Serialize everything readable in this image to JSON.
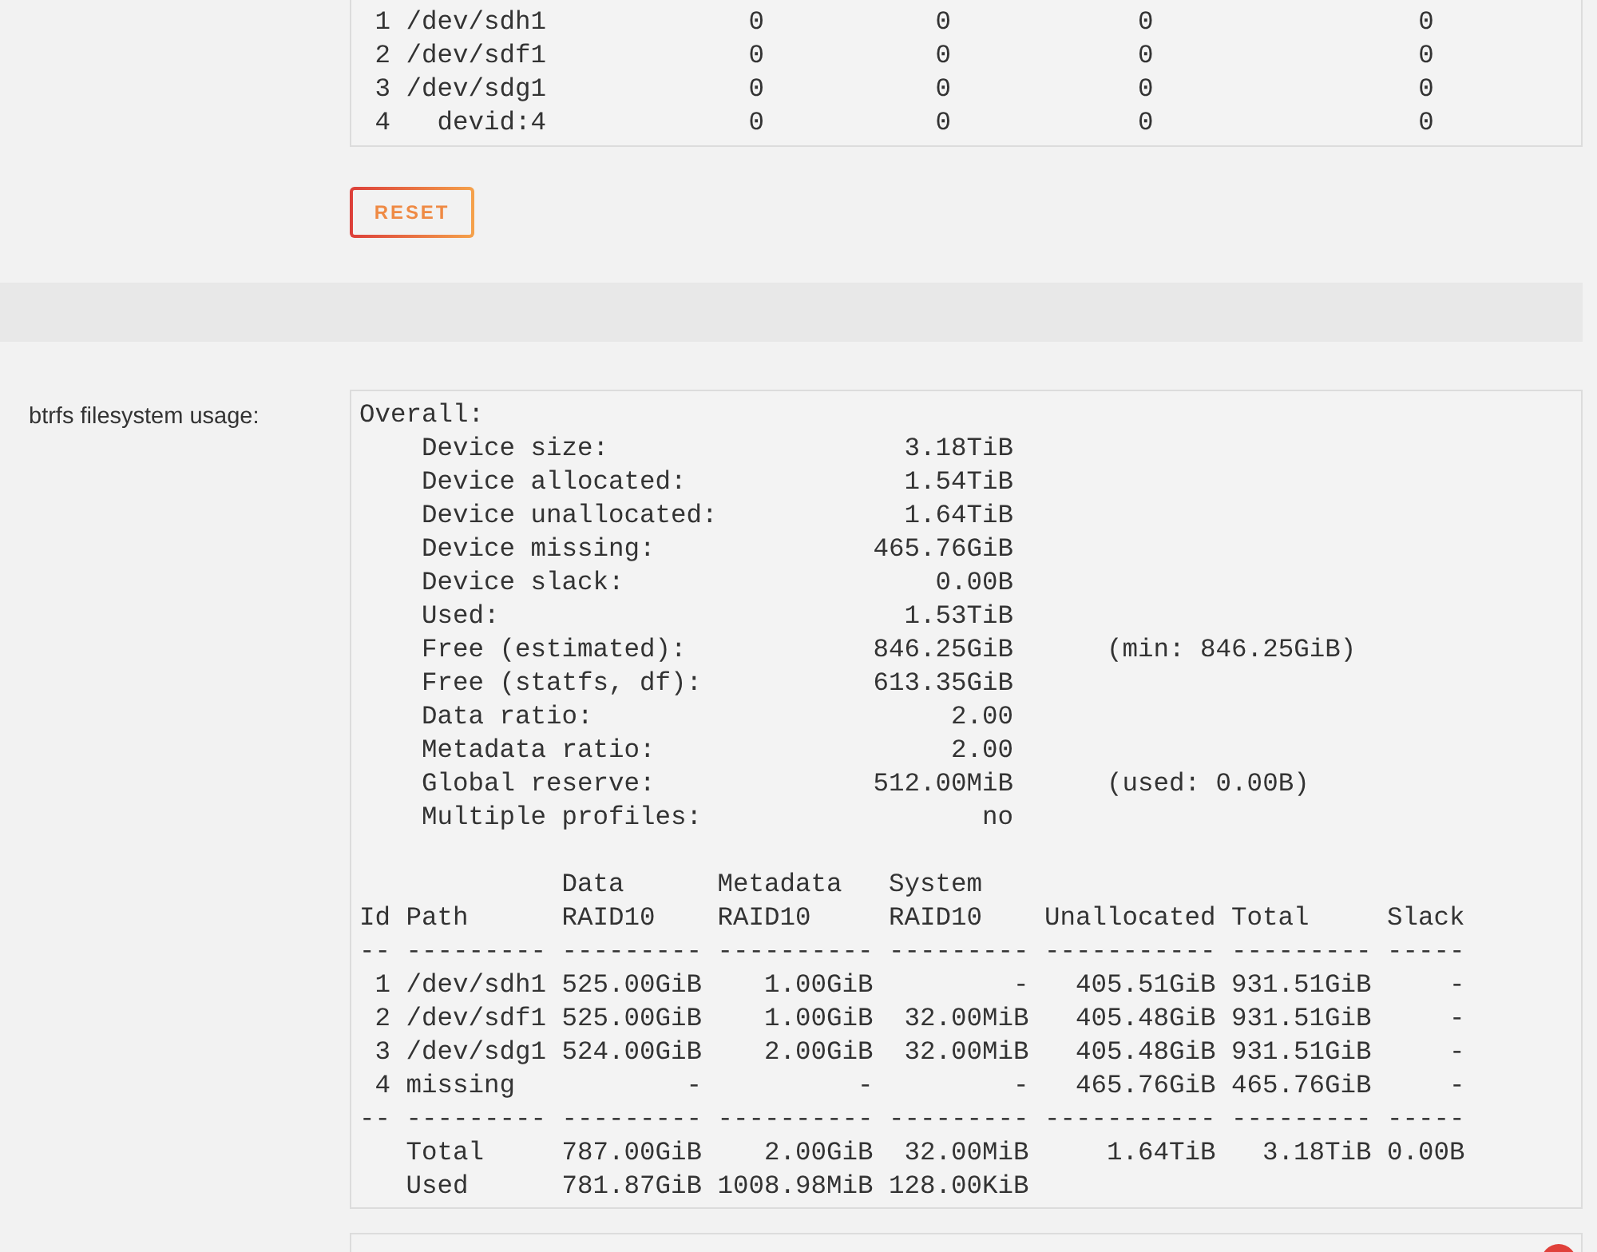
{
  "device_stats": {
    "rows": [
      {
        "id": "1",
        "path": "/dev/sdh1",
        "values": [
          "0",
          "0",
          "0",
          "0"
        ]
      },
      {
        "id": "2",
        "path": "/dev/sdf1",
        "values": [
          "0",
          "0",
          "0",
          "0"
        ]
      },
      {
        "id": "3",
        "path": "/dev/sdg1",
        "values": [
          "0",
          "0",
          "0",
          "0"
        ]
      },
      {
        "id": "4",
        "path": "  devid:4",
        "values": [
          "0",
          "0",
          "0",
          "0"
        ]
      }
    ]
  },
  "reset_button": {
    "label": "RESET"
  },
  "usage": {
    "label": "btrfs filesystem usage:",
    "overall": {
      "heading": "Overall:",
      "items": [
        {
          "label": "Device size:",
          "value": "3.18TiB"
        },
        {
          "label": "Device allocated:",
          "value": "1.54TiB"
        },
        {
          "label": "Device unallocated:",
          "value": "1.64TiB"
        },
        {
          "label": "Device missing:",
          "value": "465.76GiB"
        },
        {
          "label": "Device slack:",
          "value": "0.00B"
        },
        {
          "label": "Used:",
          "value": "1.53TiB"
        },
        {
          "label": "Free (estimated):",
          "value": "846.25GiB",
          "note": "(min: 846.25GiB)"
        },
        {
          "label": "Free (statfs, df):",
          "value": "613.35GiB"
        },
        {
          "label": "Data ratio:",
          "value": "2.00"
        },
        {
          "label": "Metadata ratio:",
          "value": "2.00"
        },
        {
          "label": "Global reserve:",
          "value": "512.00MiB",
          "note": "(used: 0.00B)"
        },
        {
          "label": "Multiple profiles:",
          "value": "no"
        }
      ]
    },
    "device_table": {
      "columns": [
        {
          "label": "Id"
        },
        {
          "label": "Path"
        },
        {
          "group": "Data",
          "label": "RAID10"
        },
        {
          "group": "Metadata",
          "label": "RAID10"
        },
        {
          "group": "System",
          "label": "RAID10"
        },
        {
          "label": "Unallocated"
        },
        {
          "label": "Total"
        },
        {
          "label": "Slack"
        }
      ],
      "rows": [
        {
          "kind": "rule",
          "cells": [
            "--",
            "---------",
            "---------",
            "----------",
            "---------",
            "-----------",
            "---------",
            "-----"
          ]
        },
        {
          "kind": "device",
          "id": "1",
          "path": "/dev/sdh1",
          "cells": [
            "525.00GiB",
            "1.00GiB",
            "-",
            "405.51GiB",
            "931.51GiB",
            "-"
          ]
        },
        {
          "kind": "device",
          "id": "2",
          "path": "/dev/sdf1",
          "cells": [
            "525.00GiB",
            "1.00GiB",
            "32.00MiB",
            "405.48GiB",
            "931.51GiB",
            "-"
          ]
        },
        {
          "kind": "device",
          "id": "3",
          "path": "/dev/sdg1",
          "cells": [
            "524.00GiB",
            "2.00GiB",
            "32.00MiB",
            "405.48GiB",
            "931.51GiB",
            "-"
          ]
        },
        {
          "kind": "device",
          "id": "4",
          "path": "missing",
          "cells": [
            "-",
            "-",
            "-",
            "465.76GiB",
            "465.76GiB",
            "-"
          ]
        },
        {
          "kind": "rule",
          "cells": [
            "--",
            "---------",
            "---------",
            "----------",
            "---------",
            "-----------",
            "---------",
            "-----"
          ]
        },
        {
          "kind": "summary",
          "label": "Total",
          "cells": [
            "787.00GiB",
            "2.00GiB",
            "32.00MiB",
            "1.64TiB",
            "3.18TiB",
            "0.00B"
          ]
        },
        {
          "kind": "summary",
          "label": "Used",
          "cells": [
            "781.87GiB",
            "1008.98MiB",
            "128.00KiB"
          ]
        }
      ]
    }
  }
}
